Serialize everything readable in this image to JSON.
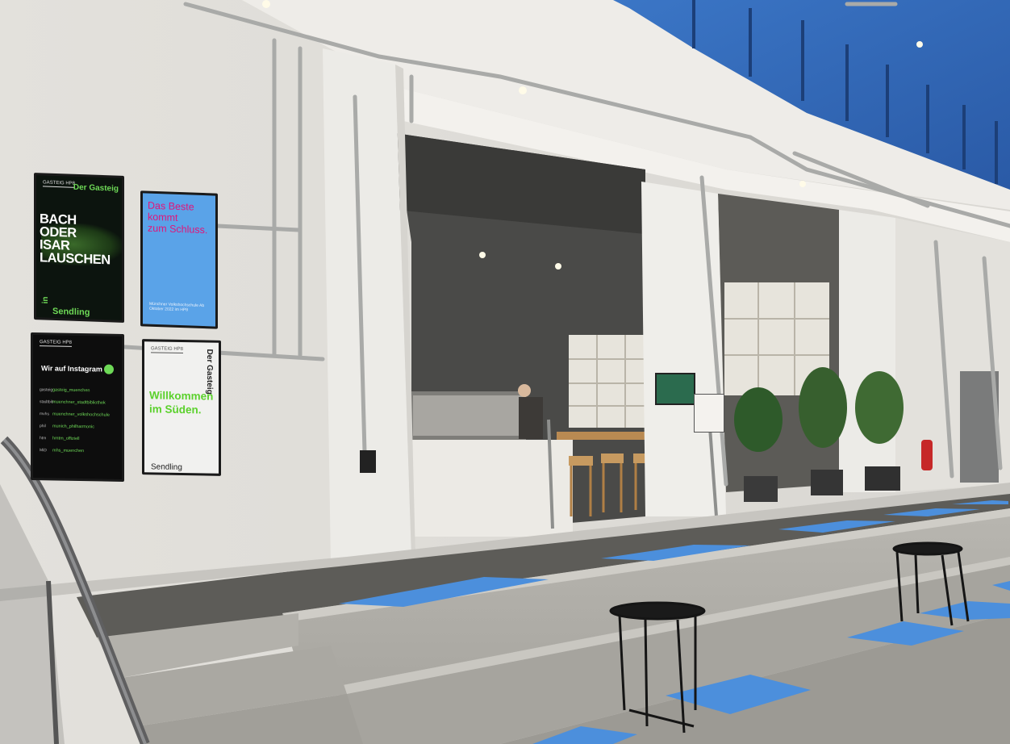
{
  "screens": {
    "bach": {
      "logo": "GASTEIG HP8",
      "brand": "Der Gasteig",
      "title_lines": [
        "BACH",
        "ODER",
        "ISAR",
        "LAUSCHEN"
      ],
      "in": "in",
      "location": "Sendling"
    },
    "beste": {
      "title_lines": [
        "Das Beste",
        "kommt",
        "zum Schluss."
      ],
      "small": "Münchner Volkshochschule Ab Oktober 2022 im HP8"
    },
    "instagram": {
      "logo": "GASTEIG HP8",
      "title": "Wir auf Instagram",
      "handles": [
        {
          "org": "gasteig",
          "handle": "gasteig_muenchen"
        },
        {
          "org": "stadtbib",
          "handle": "muenchner_stadtbibliothek"
        },
        {
          "org": "mvhs",
          "handle": "muenchner_volkshochschule"
        },
        {
          "org": "phil",
          "handle": "munich_philharmonic"
        },
        {
          "org": "htm",
          "handle": "hmtm_offiziell"
        },
        {
          "org": "MiD",
          "handle": "mhs_muenchen"
        }
      ]
    },
    "willkommen": {
      "logo": "GASTEIG HP8",
      "brand": "Der Gasteig",
      "title_lines": [
        "Willkommen",
        "im Süden."
      ],
      "location": "Sendling"
    }
  },
  "colors": {
    "accent_green": "#6ed957",
    "blue_mat": "#4c8fdc",
    "glass_blue": "#2f66b5"
  }
}
